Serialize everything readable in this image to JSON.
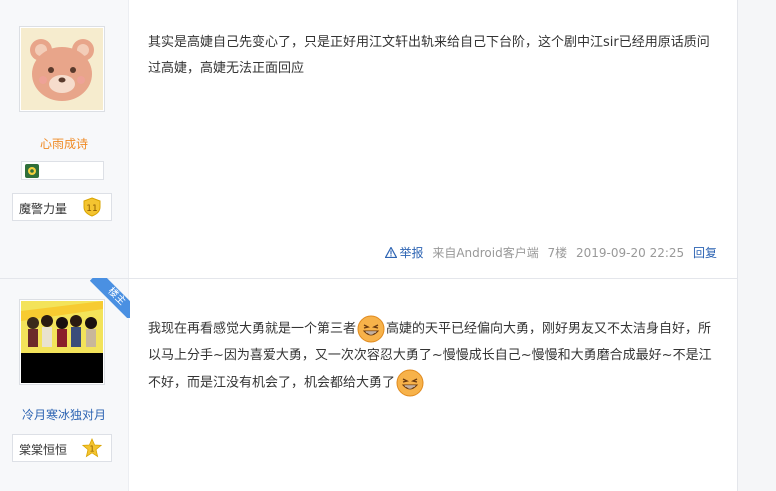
{
  "posts": [
    {
      "username": "心雨成诗",
      "level_title": "魔警力量",
      "level_num": "11",
      "content": "其实是高婕自己先变心了，只是正好用江文轩出轨来给自己下台阶，这个剧中江sir已经用原话质问过高婕，高婕无法正面回应",
      "meta": {
        "report": "举报",
        "source": "来自Android客户端",
        "floor": "7楼",
        "time": "2019-09-20 22:25",
        "reply": "回复"
      }
    },
    {
      "username": "冷月寒冰独对月",
      "level_title": "棠棠恒恒",
      "level_num": "1",
      "ribbon": "楼主",
      "content_parts": [
        "我现在再看感觉大勇就是一个第三者",
        "高婕的天平已经偏向大勇，刚好男友又不太洁身自好，所以马上分手~因为喜爱大勇，又一次次容忍大勇了~慢慢成长自己~慢慢和大勇磨合成最好~不是江不好，而是江没有机会了，机会都给大勇了"
      ]
    }
  ],
  "icons": {
    "warning": "warning-icon",
    "emoji": "grin-emoji-icon"
  },
  "colors": {
    "username_orange": "#f08a24",
    "link_blue": "#2d64b3",
    "ribbon": "#4a90e2",
    "level_gold": "#f4c430"
  }
}
